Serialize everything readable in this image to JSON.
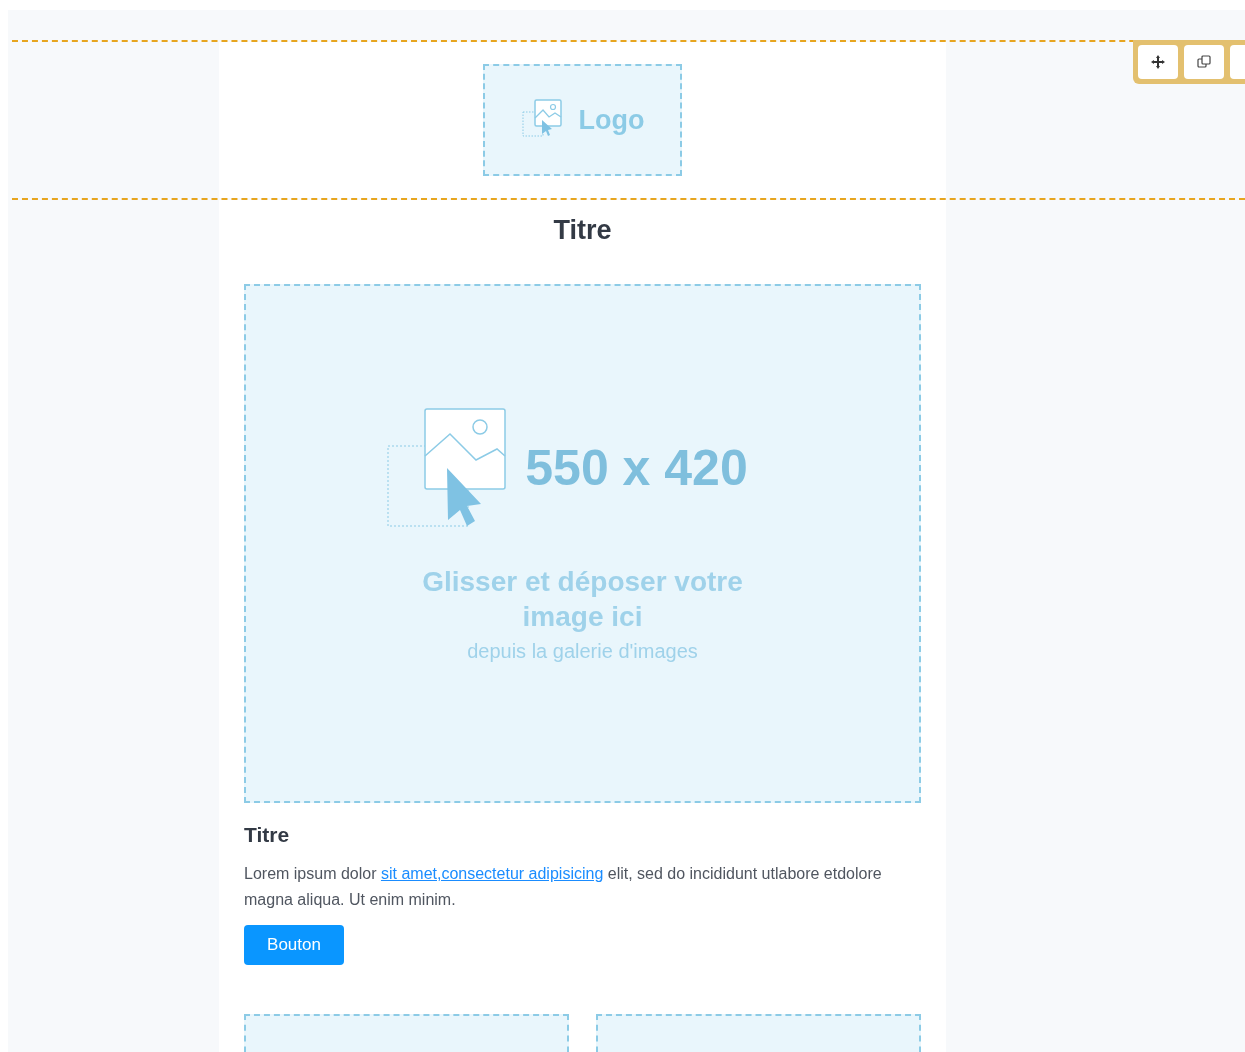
{
  "toolbar": {
    "buttons": [
      {
        "kind": "move"
      },
      {
        "kind": "duplicate"
      },
      {
        "kind": "other"
      }
    ]
  },
  "header": {
    "logo": {
      "label": "Logo"
    }
  },
  "title": "Titre",
  "image_placeholder": {
    "size": "550 x 420",
    "caption": "Glisser et déposer votre image ici",
    "subcaption": "depuis la galerie d'images"
  },
  "article": {
    "title": "Titre",
    "text_before": "Lorem ipsum dolor ",
    "link": "sit amet,consectetur adipisicing",
    "text_after": " elit, sed do incididunt utlabore etdolore magna aliqua. Ut enim minim.",
    "button": "Bouton"
  }
}
